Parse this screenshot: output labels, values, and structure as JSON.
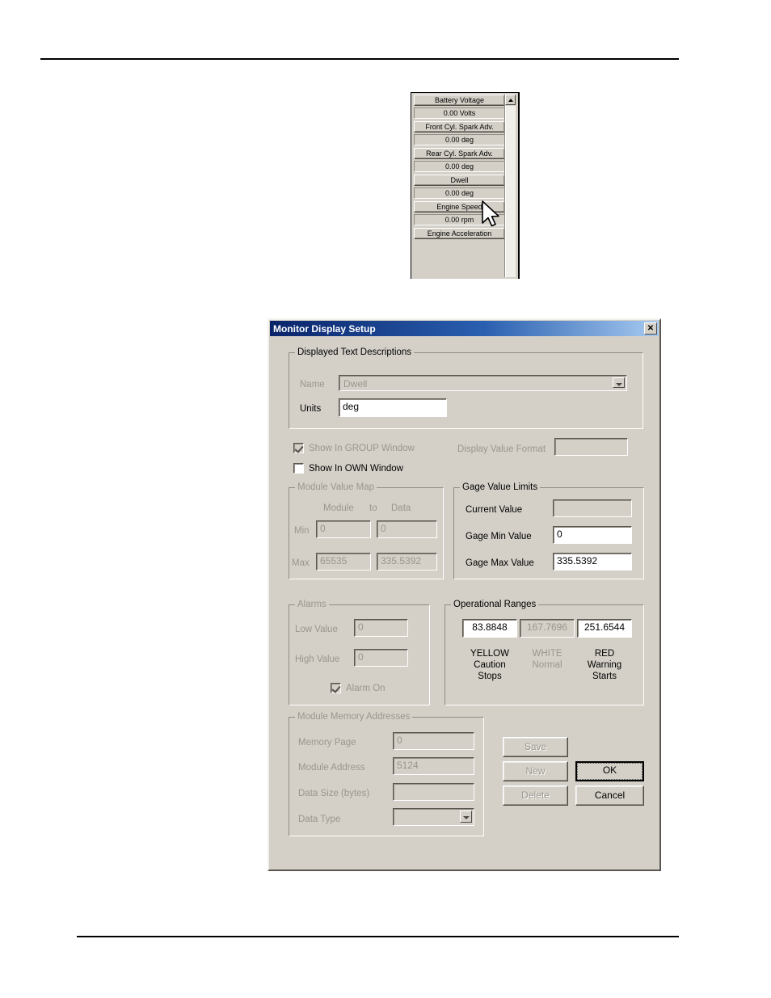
{
  "monitor_window": {
    "items": [
      {
        "name": "Battery Voltage",
        "value": "0.00 Volts"
      },
      {
        "name": "Front Cyl. Spark Adv.",
        "value": "0.00 deg"
      },
      {
        "name": "Rear Cyl. Spark Adv.",
        "value": "0.00 deg"
      },
      {
        "name": "Dwell",
        "value": "0.00 deg"
      },
      {
        "name": "Engine Speed",
        "value": "0.00 rpm"
      },
      {
        "name": "Engine Acceleration",
        "value": ""
      }
    ],
    "scroll_up_icon": "scroll-up-arrow-icon"
  },
  "dialog": {
    "title": "Monitor Display Setup",
    "close_label": "✕",
    "displayed_text": {
      "group_label": "Displayed Text Descriptions",
      "name_label": "Name",
      "name_value": "Dwell",
      "units_label": "Units",
      "units_value": "deg"
    },
    "options": {
      "show_group_label": "Show In GROUP Window",
      "show_group_checked": true,
      "show_own_label": "Show In OWN Window",
      "show_own_checked": false,
      "display_value_format_label": "Display Value Format",
      "display_value_format_value": ""
    },
    "module_value_map": {
      "group_label": "Module Value Map",
      "col_module": "Module",
      "col_to": "to",
      "col_data": "Data",
      "min_label": "Min",
      "min_module": "0",
      "min_data": "0",
      "max_label": "Max",
      "max_module": "65535",
      "max_data": "335.5392"
    },
    "gage_value_limits": {
      "group_label": "Gage Value Limits",
      "current_label": "Current Value",
      "current_value": "",
      "min_label": "Gage Min Value",
      "min_value": "0",
      "max_label": "Gage Max Value",
      "max_value": "335.5392"
    },
    "alarms": {
      "group_label": "Alarms",
      "low_label": "Low Value",
      "low_value": "0",
      "high_label": "High Value",
      "high_value": "0",
      "alarm_on_label": "Alarm On",
      "alarm_on_checked": true
    },
    "operational_ranges": {
      "group_label": "Operational Ranges",
      "yellow_value": "83.8848",
      "white_value": "167.7696",
      "red_value": "251.6544",
      "yellow_caption": "YELLOW\nCaution\nStops",
      "white_caption": "WHITE\nNormal",
      "red_caption": "RED\nWarning\nStarts",
      "yellow_l1": "YELLOW",
      "yellow_l2": "Caution",
      "yellow_l3": "Stops",
      "white_l1": "WHITE",
      "white_l2": "Normal",
      "red_l1": "RED",
      "red_l2": "Warning",
      "red_l3": "Starts"
    },
    "module_memory": {
      "group_label": "Module Memory Addresses",
      "memory_page_label": "Memory Page",
      "memory_page_value": "0",
      "module_address_label": "Module Address",
      "module_address_value": "5124",
      "data_size_label": "Data Size (bytes)",
      "data_size_value": "",
      "data_type_label": "Data Type",
      "data_type_value": ""
    },
    "buttons": {
      "save": "Save",
      "new": "New",
      "delete": "Delete",
      "ok": "OK",
      "cancel": "Cancel"
    }
  },
  "colors": {
    "dialog_face": "#d4d0c8",
    "title_gradient_start": "#0a246a",
    "title_gradient_end": "#a6caf0",
    "disabled_text": "#9a968e",
    "field_bg": "#ffffff"
  }
}
